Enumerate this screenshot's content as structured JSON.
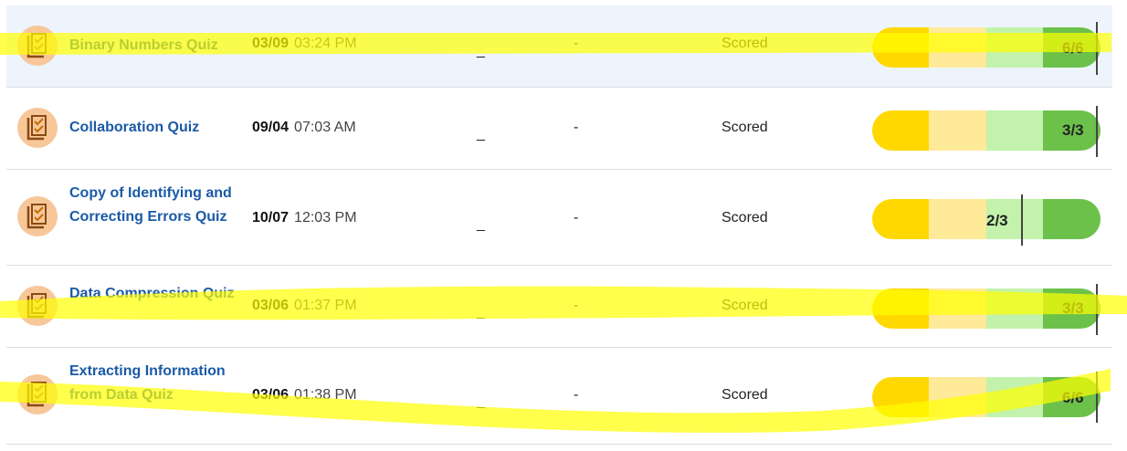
{
  "rows": [
    {
      "title": "Binary Numbers Quiz",
      "date": "03/09",
      "time": "03:24 PM",
      "col1": "_",
      "col2": "-",
      "status": "Scored",
      "score": "6/6"
    },
    {
      "title": "Collaboration Quiz",
      "date": "09/04",
      "time": "07:03 AM",
      "col1": "_",
      "col2": "-",
      "status": "Scored",
      "score": "3/3"
    },
    {
      "title": "Copy of Identifying and Correcting Errors Quiz",
      "date": "10/07",
      "time": "12:03 PM",
      "col1": "_",
      "col2": "-",
      "status": "Scored",
      "score": "2/3"
    },
    {
      "title": "Data Compression Quiz",
      "date": "03/06",
      "time": "01:37 PM",
      "col1": "_",
      "col2": "-",
      "status": "Scored",
      "score": "3/3"
    },
    {
      "title": "Extracting Information from Data Quiz",
      "date": "03/06",
      "time": "01:38 PM",
      "col1": "_",
      "col2": "-",
      "status": "Scored",
      "score": "6/6"
    }
  ],
  "icons": {
    "row_icon": "quiz-checklist-icon"
  },
  "colors": {
    "title": "#1a5aa6",
    "bar_segments": [
      "#ffd800",
      "#ffea9a",
      "#c2f2ac",
      "#6cc14a"
    ],
    "highlighter": "#ffff00",
    "selected_row": "#eef4fc"
  },
  "score_fractions": [
    1.0,
    1.0,
    0.667,
    1.0,
    1.0
  ]
}
